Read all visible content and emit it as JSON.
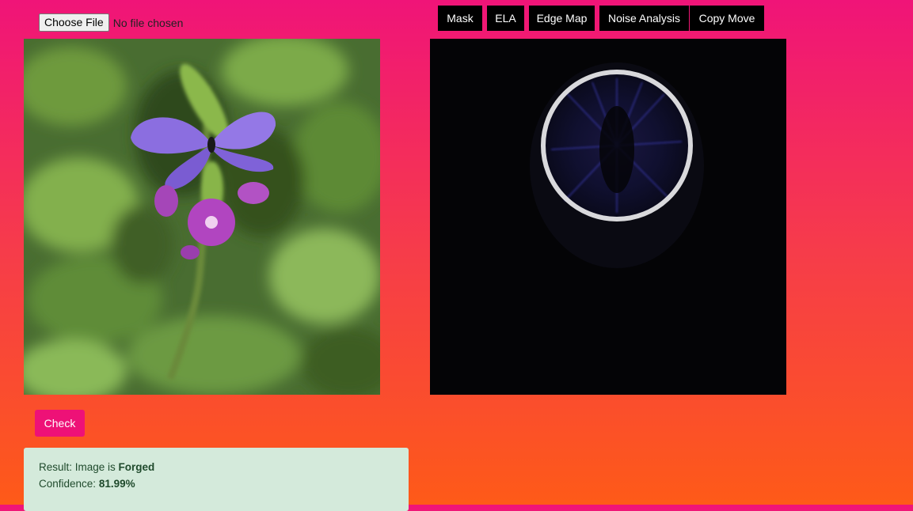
{
  "upload": {
    "button_label": "Choose File",
    "status": "No file chosen"
  },
  "tabs": [
    {
      "label": "Mask"
    },
    {
      "label": "ELA"
    },
    {
      "label": "Edge Map"
    },
    {
      "label": "Noise Analysis"
    },
    {
      "label": "Copy Move"
    }
  ],
  "actions": {
    "check_label": "Check"
  },
  "result": {
    "result_prefix": "Result: Image is ",
    "result_value": "Forged",
    "confidence_prefix": "Confidence: ",
    "confidence_value": "81.99%"
  },
  "colors": {
    "accent": "#ee1177",
    "gradient_top": "#f01478",
    "gradient_bottom": "#fe5a18",
    "result_bg": "#d4eadb",
    "tab_bg": "#000000"
  }
}
